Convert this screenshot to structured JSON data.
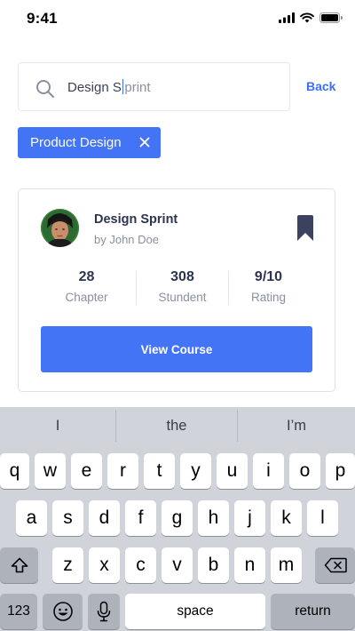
{
  "status_bar": {
    "time": "9:41"
  },
  "search": {
    "typed": "Design S",
    "remainder": "print",
    "back_label": "Back"
  },
  "filter_chip": {
    "label": "Product Design"
  },
  "course": {
    "title": "Design Sprint",
    "author": "by John Doe",
    "stats": [
      {
        "value": "28",
        "label": "Chapter"
      },
      {
        "value": "308",
        "label": "Stundent"
      },
      {
        "value": "9/10",
        "label": "Rating"
      }
    ],
    "cta_label": "View Course"
  },
  "keyboard": {
    "suggestions": [
      "I",
      "the",
      "I’m"
    ],
    "row1": [
      "q",
      "w",
      "e",
      "r",
      "t",
      "y",
      "u",
      "i",
      "o",
      "p"
    ],
    "row2": [
      "a",
      "s",
      "d",
      "f",
      "g",
      "h",
      "j",
      "k",
      "l"
    ],
    "row3": [
      "z",
      "x",
      "c",
      "v",
      "b",
      "n",
      "m"
    ],
    "numbers_label": "123",
    "space_label": "space",
    "return_label": "return",
    "icons": [
      "shift-icon",
      "backspace-icon",
      "emoji-icon",
      "microphone-icon"
    ]
  },
  "colors": {
    "accent": "#4474f6",
    "text_primary": "#2d3450",
    "text_secondary": "#8b90a0",
    "keyboard_bg": "#d0d3d9"
  }
}
